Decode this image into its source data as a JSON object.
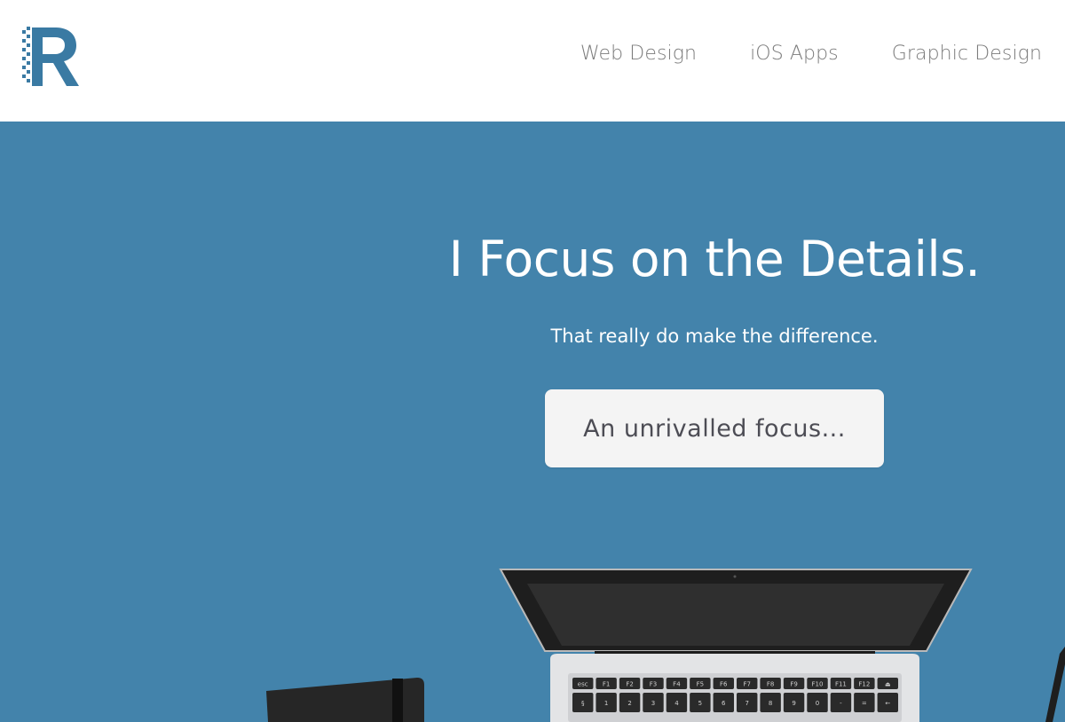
{
  "header": {
    "logo_letter": "R",
    "nav": [
      {
        "label": "Web Design"
      },
      {
        "label": "iOS Apps"
      },
      {
        "label": "Graphic Design"
      }
    ]
  },
  "hero": {
    "title": "I Focus on the Details.",
    "subtitle": "That really do make the difference.",
    "cta_label": "An unrivalled focus...",
    "keyboard_row1": [
      "esc",
      "F1",
      "F2",
      "F3",
      "F4",
      "F5",
      "F6",
      "F7",
      "F8",
      "F9",
      "F10",
      "F11",
      "F12",
      "⏏"
    ],
    "keyboard_row2": [
      "§",
      "1",
      "2",
      "3",
      "4",
      "5",
      "6",
      "7",
      "8",
      "9",
      "0",
      "-",
      "=",
      "←"
    ]
  },
  "colors": {
    "hero_bg": "#4383ab",
    "logo": "#3a7aa3",
    "nav_text": "#7b7b7b",
    "cta_bg": "#f4f4f4",
    "cta_text": "#4d4d55"
  }
}
